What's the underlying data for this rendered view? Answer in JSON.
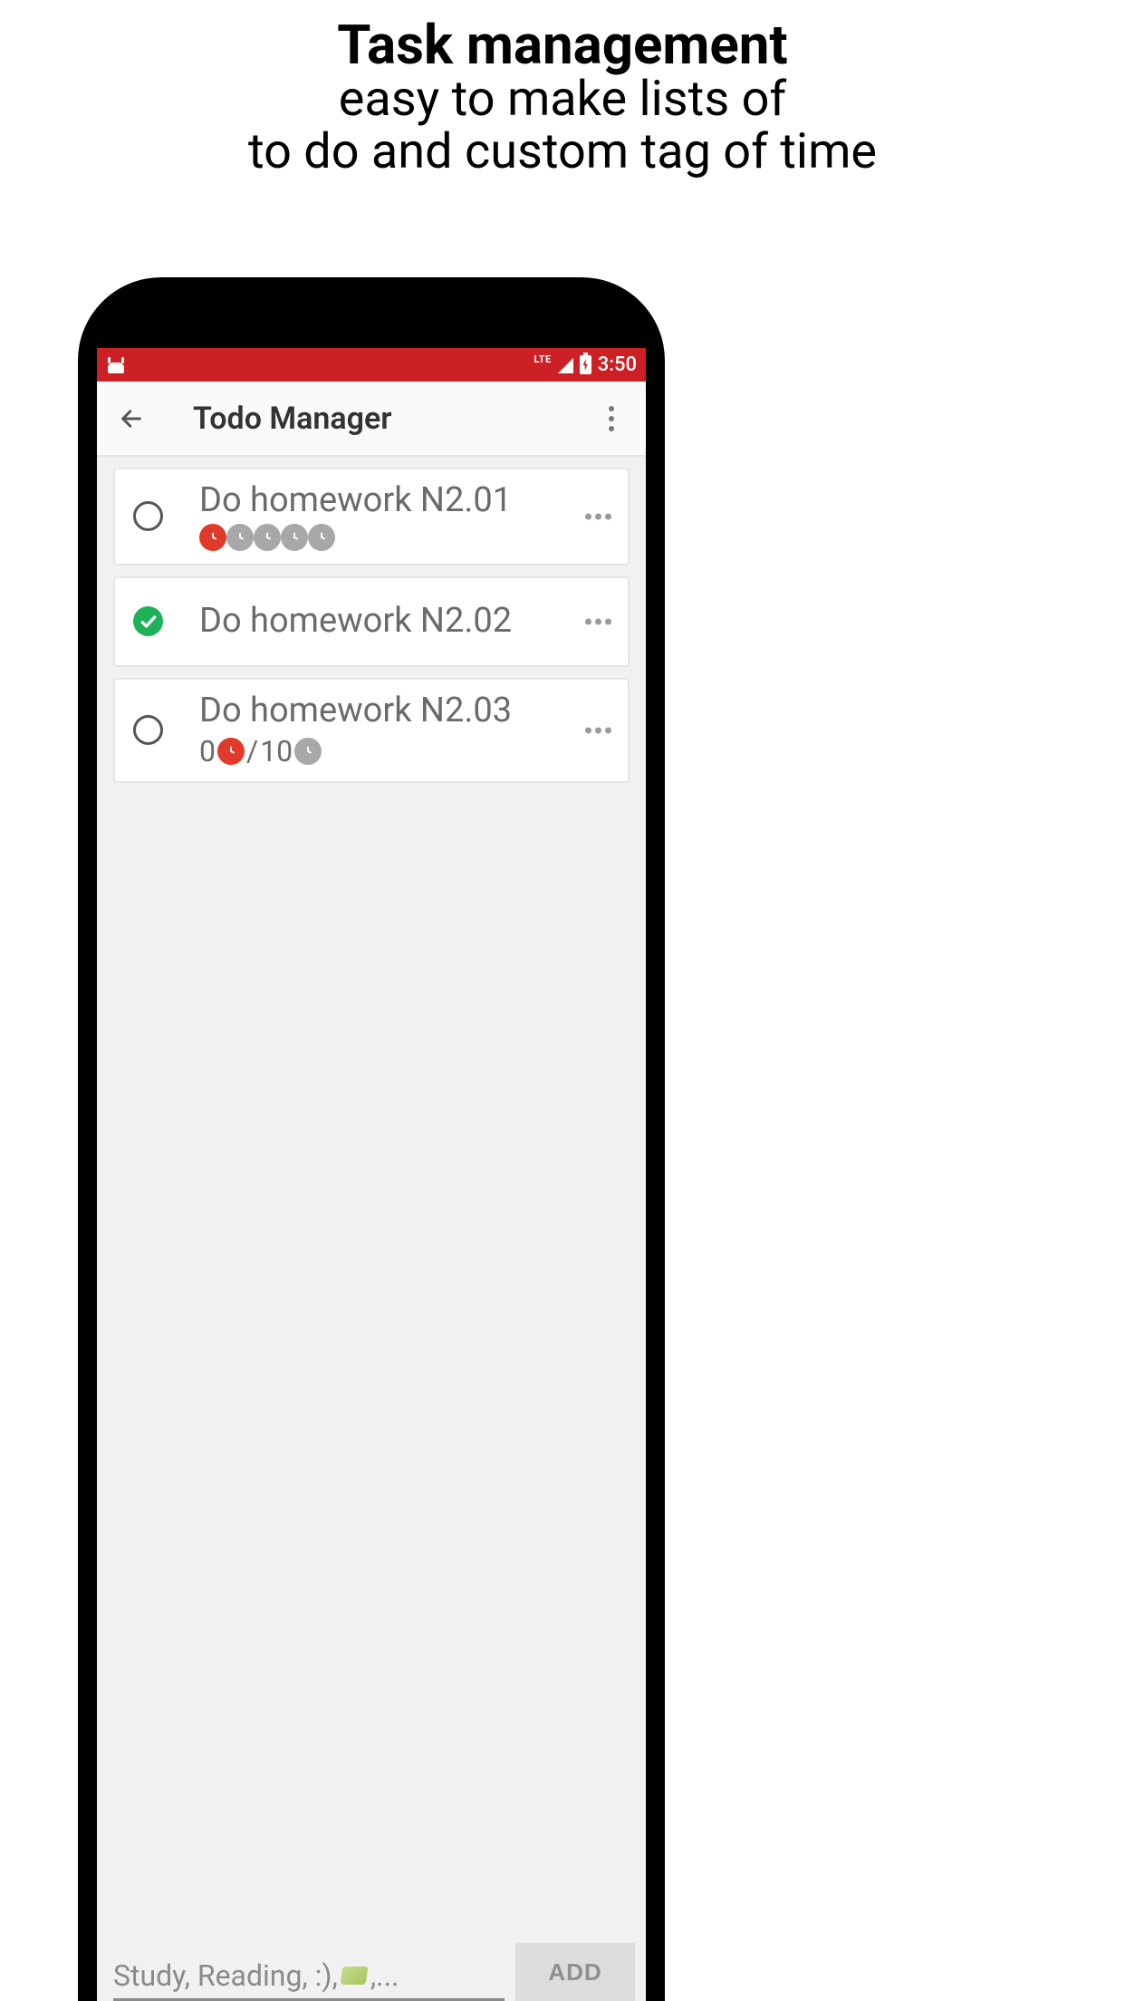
{
  "promo": {
    "title": "Task management",
    "line1": "easy to make lists of",
    "line2": "to do and custom tag of time"
  },
  "status": {
    "time": "3:50",
    "network": "LTE"
  },
  "appbar": {
    "title": "Todo Manager"
  },
  "todos": [
    {
      "title": "Do homework N2.01",
      "completed": false,
      "tag_type": "clocks",
      "clocks_red": 1,
      "clocks_grey": 4
    },
    {
      "title": "Do homework N2.02",
      "completed": true,
      "tag_type": "none"
    },
    {
      "title": "Do homework N2.03",
      "completed": false,
      "tag_type": "ratio",
      "done": "0",
      "total": "10"
    }
  ],
  "input": {
    "placeholder_pre": "Study, Reading, :), ",
    "placeholder_post": ",...",
    "add_label": "ADD"
  }
}
